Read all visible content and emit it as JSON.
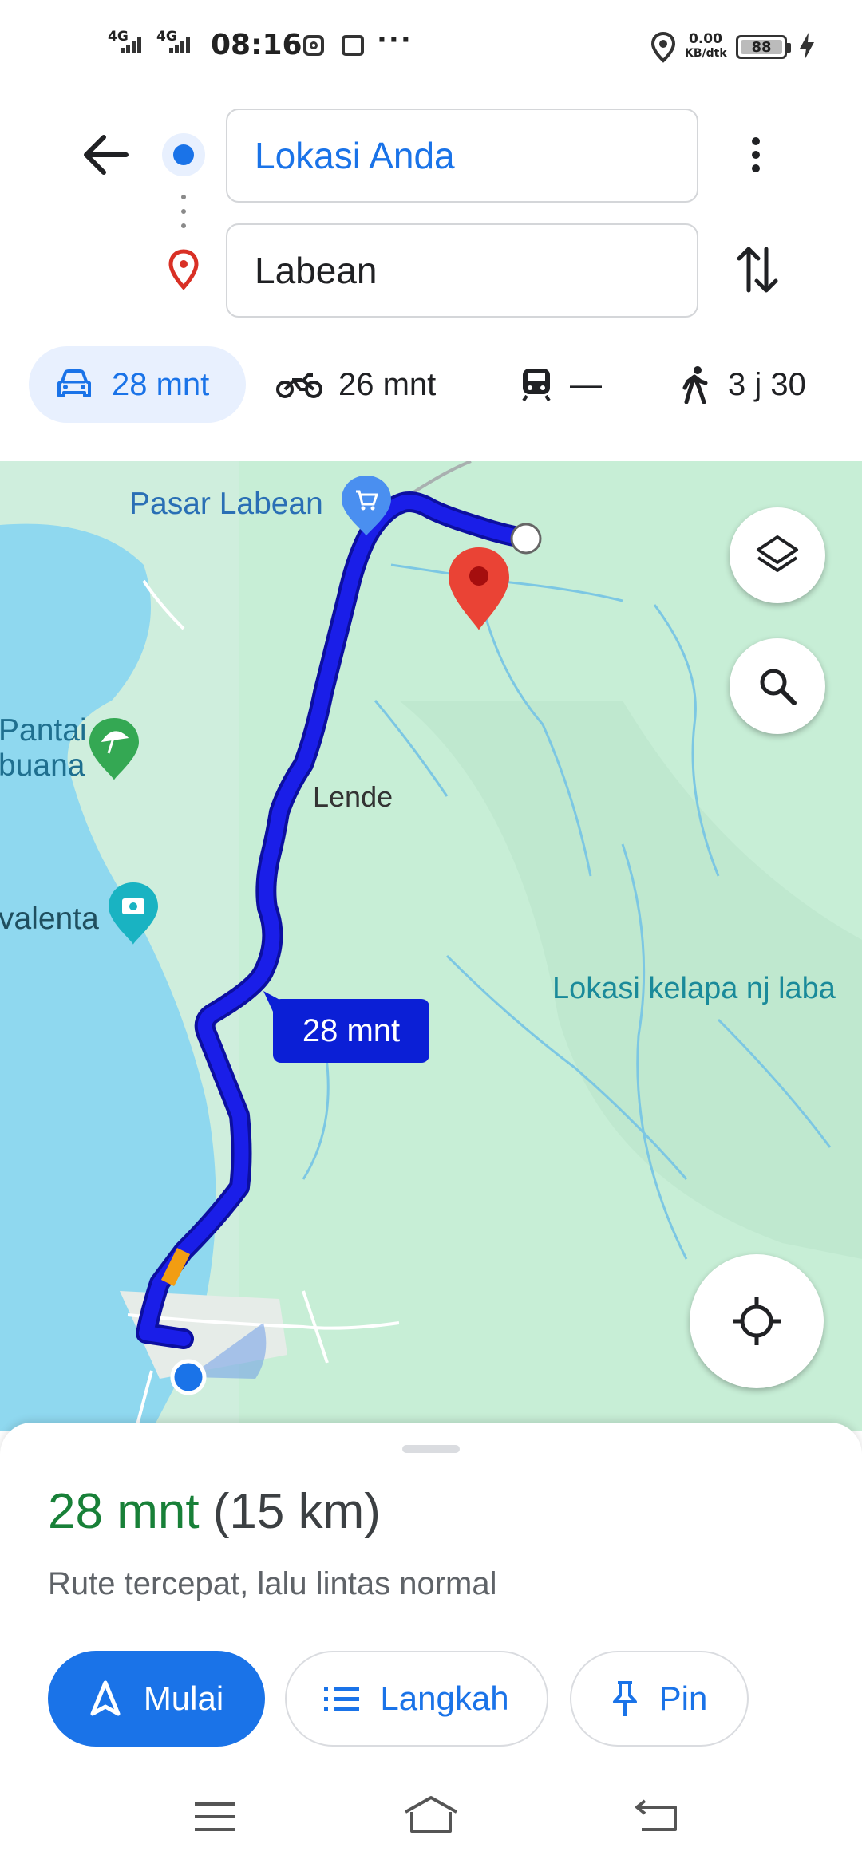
{
  "status_bar": {
    "signal1": "4G",
    "signal2": "4G",
    "time": "08:16",
    "more": "···",
    "speed_value": "0.00",
    "speed_unit": "KB/dtk",
    "battery": "88"
  },
  "header": {
    "origin": "Lokasi Anda",
    "destination": "Labean"
  },
  "modes": [
    {
      "name": "car",
      "label": "28 mnt"
    },
    {
      "name": "motorcycle",
      "label": "26 mnt"
    },
    {
      "name": "transit",
      "label": "—"
    },
    {
      "name": "walk",
      "label": "3 j 30"
    }
  ],
  "map": {
    "labels": {
      "pasar": "Pasar Labean",
      "pantai_1": "Pantai",
      "pantai_2": "buana",
      "valenta": "valenta",
      "lende": "Lende",
      "lokasi_kelapa": "Lokasi kelapa nj laba"
    },
    "route_badge": "28 mnt"
  },
  "summary": {
    "duration": "28 mnt",
    "distance": "(15 km)",
    "note": "Rute tercepat, lalu lintas normal"
  },
  "actions": {
    "start": "Mulai",
    "steps": "Langkah",
    "pin": "Pin"
  },
  "colors": {
    "accent": "#1a73e8",
    "route": "#1a1ee8",
    "duration_green": "#188038",
    "water": "#8fd8ef",
    "land": "#cfeedd"
  }
}
